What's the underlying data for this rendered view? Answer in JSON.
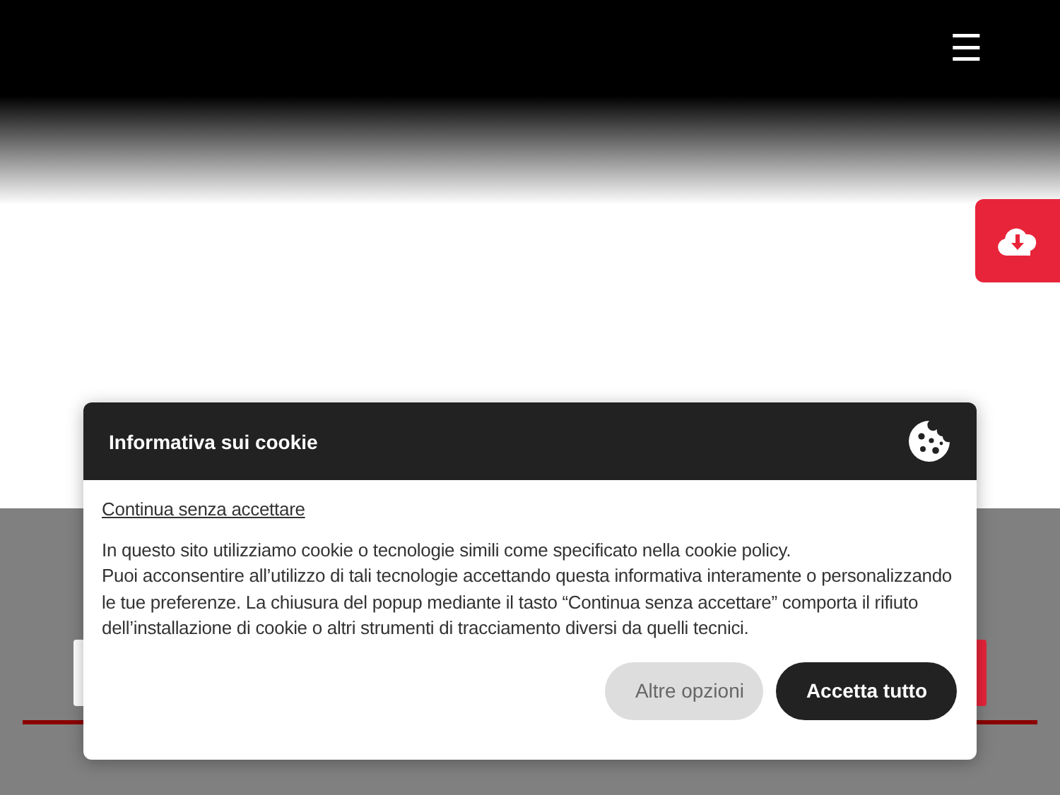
{
  "header": {
    "menu": "☰"
  },
  "cookie_dialog": {
    "title": "Informativa sui cookie",
    "continue_link": "Continua senza accettare",
    "paragraphs": [
      "In questo sito utilizziamo cookie o tecnologie simili come specificato nella cookie policy.",
      "Puoi acconsentire all’utilizzo di tali tecnologie accettando questa informativa interamente o personalizzando le tue preferenze. La chiusura del popup mediante il tasto “Continua senza accettare” comporta il rifiuto dell’installazione di cookie o altri strumenti di tracciamento diversi da quelli tecnici."
    ],
    "buttons": [
      {
        "label": "Altre opzioni",
        "kind": "secondary"
      },
      {
        "label": "Accetta tutto",
        "kind": "primary"
      }
    ]
  }
}
